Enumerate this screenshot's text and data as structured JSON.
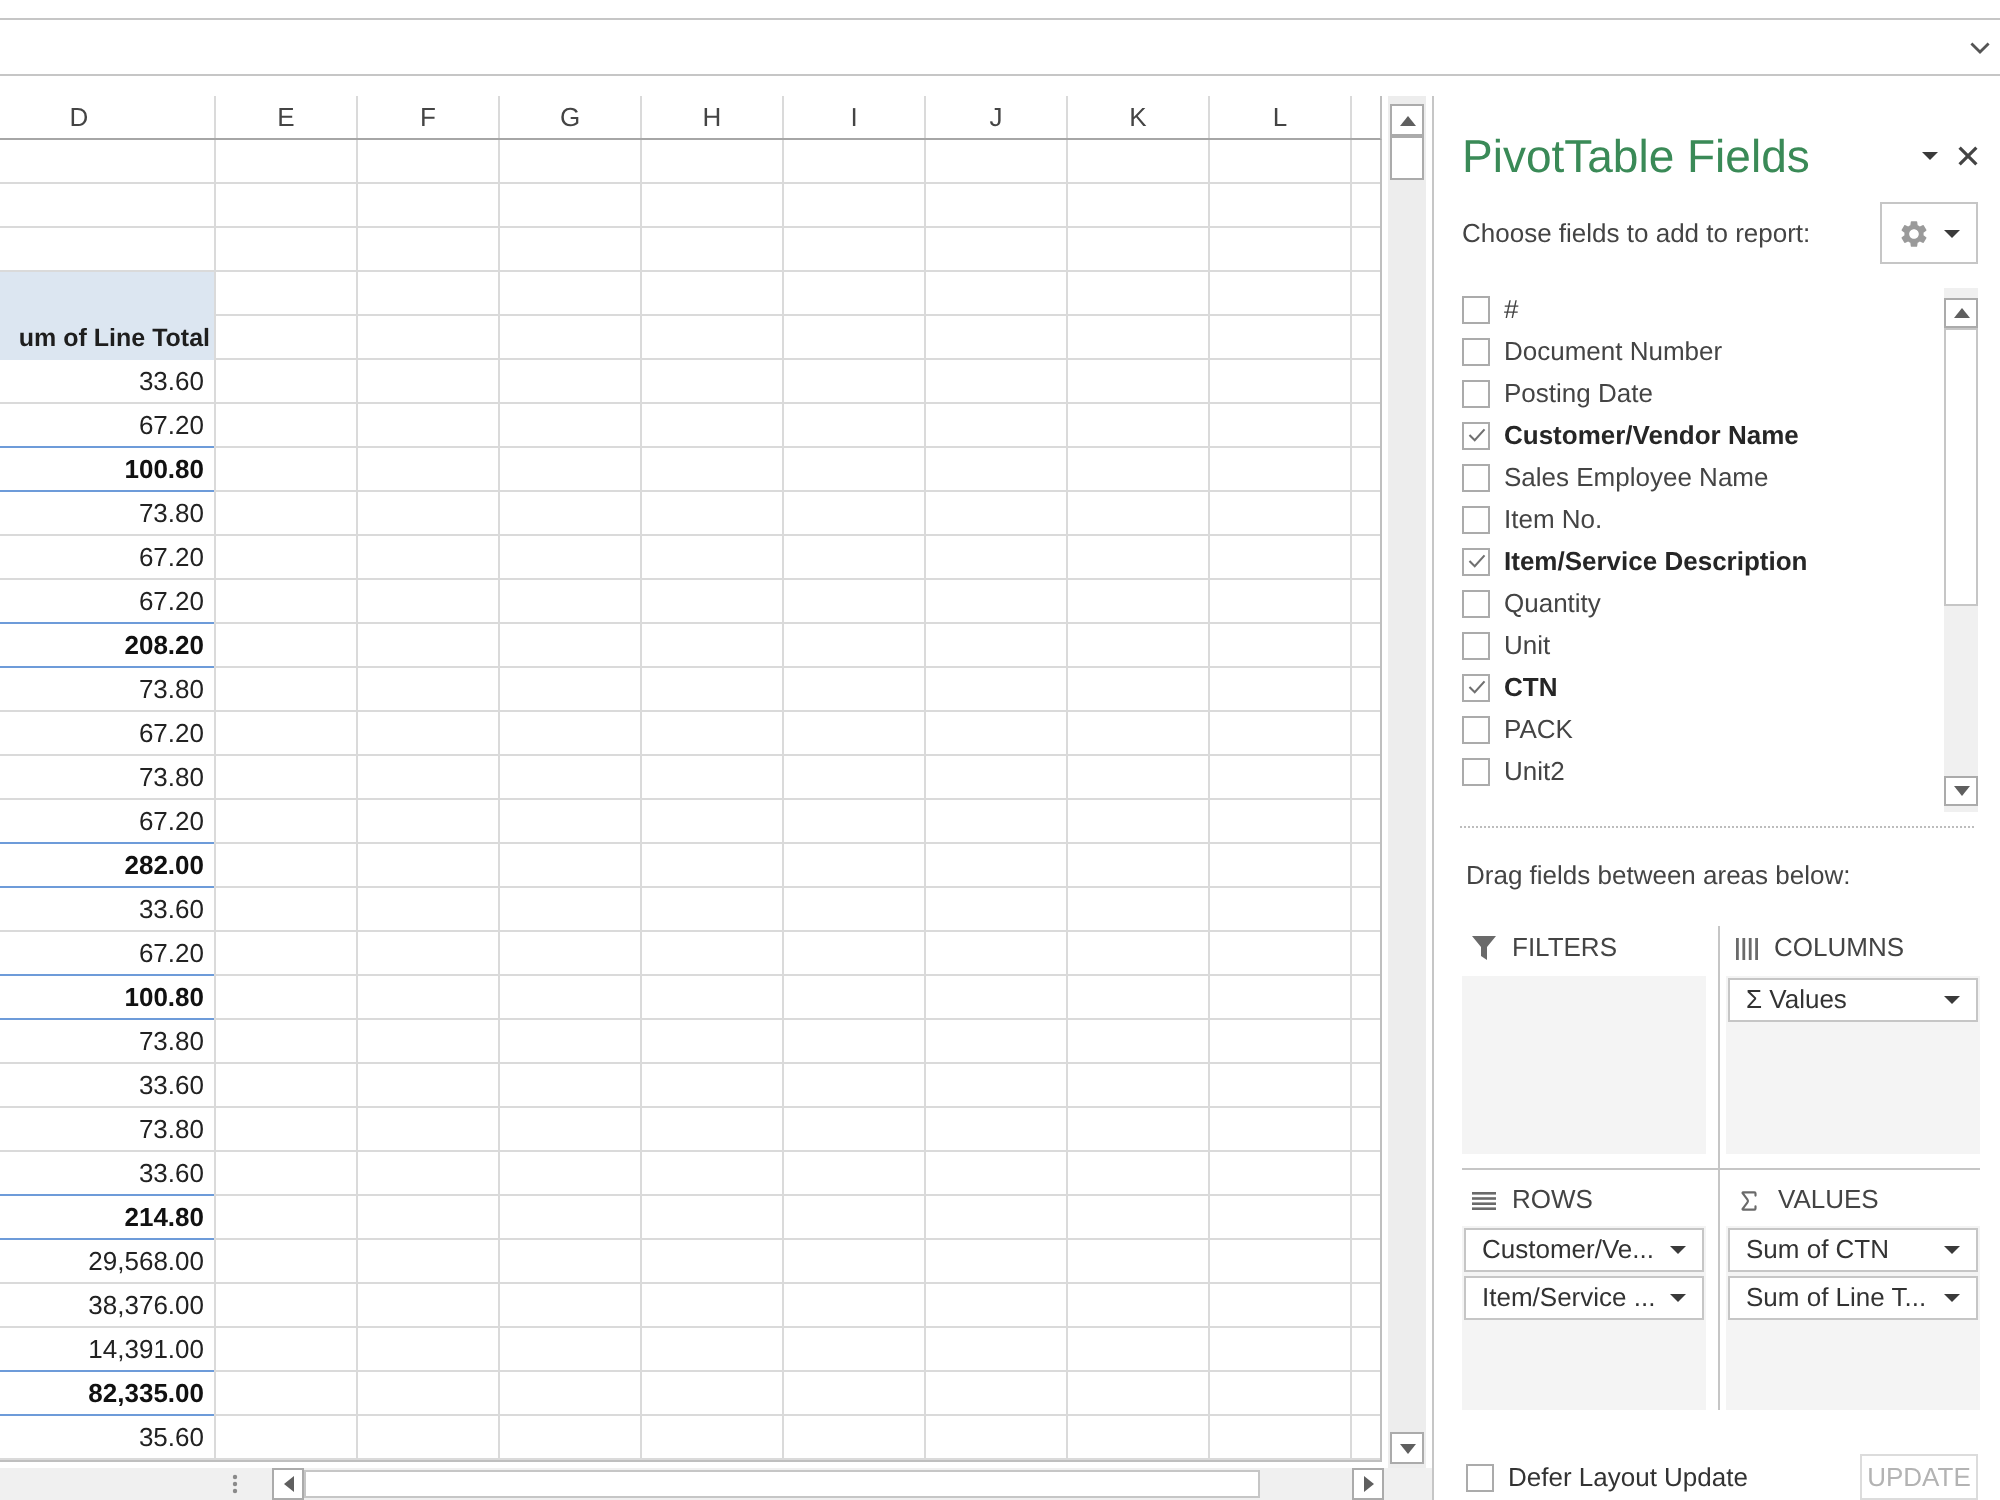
{
  "sheet": {
    "columns": [
      "D",
      "E",
      "F",
      "G",
      "H",
      "I",
      "J",
      "K",
      "L"
    ],
    "rows": [
      {
        "kind": "blank"
      },
      {
        "kind": "blank"
      },
      {
        "kind": "blank"
      },
      {
        "kind": "pivot_header"
      },
      {
        "kind": "pivot_header",
        "text": "um of Line Total"
      },
      {
        "kind": "value",
        "text": "33.60"
      },
      {
        "kind": "value",
        "text": "67.20"
      },
      {
        "kind": "subtotal",
        "text": "100.80"
      },
      {
        "kind": "value",
        "text": "73.80"
      },
      {
        "kind": "value",
        "text": "67.20"
      },
      {
        "kind": "value",
        "text": "67.20"
      },
      {
        "kind": "subtotal",
        "text": "208.20"
      },
      {
        "kind": "value",
        "text": "73.80"
      },
      {
        "kind": "value",
        "text": "67.20"
      },
      {
        "kind": "value",
        "text": "73.80"
      },
      {
        "kind": "value",
        "text": "67.20"
      },
      {
        "kind": "subtotal",
        "text": "282.00"
      },
      {
        "kind": "value",
        "text": "33.60"
      },
      {
        "kind": "value",
        "text": "67.20"
      },
      {
        "kind": "subtotal",
        "text": "100.80"
      },
      {
        "kind": "value",
        "text": "73.80"
      },
      {
        "kind": "value",
        "text": "33.60"
      },
      {
        "kind": "value",
        "text": "73.80"
      },
      {
        "kind": "value",
        "text": "33.60"
      },
      {
        "kind": "subtotal",
        "text": "214.80"
      },
      {
        "kind": "value",
        "text": "29,568.00"
      },
      {
        "kind": "value",
        "text": "38,376.00"
      },
      {
        "kind": "value",
        "text": "14,391.00"
      },
      {
        "kind": "subtotal",
        "text": "82,335.00"
      },
      {
        "kind": "value",
        "text": "35.60"
      }
    ]
  },
  "pivot_panel": {
    "title": "PivotTable Fields",
    "subtitle": "Choose fields to add to report:",
    "fields": [
      {
        "label": "#",
        "checked": false
      },
      {
        "label": "Document Number",
        "checked": false
      },
      {
        "label": "Posting Date",
        "checked": false
      },
      {
        "label": "Customer/Vendor Name",
        "checked": true
      },
      {
        "label": "Sales Employee Name",
        "checked": false
      },
      {
        "label": "Item No.",
        "checked": false
      },
      {
        "label": "Item/Service Description",
        "checked": true
      },
      {
        "label": "Quantity",
        "checked": false
      },
      {
        "label": "Unit",
        "checked": false
      },
      {
        "label": "CTN",
        "checked": true
      },
      {
        "label": "PACK",
        "checked": false
      },
      {
        "label": "Unit2",
        "checked": false
      }
    ],
    "areas_hint": "Drag fields between areas below:",
    "areas": [
      {
        "kind": "filters",
        "label": "FILTERS"
      },
      {
        "kind": "columns",
        "label": "COLUMNS",
        "items": [
          "Σ Values"
        ]
      },
      {
        "kind": "rows",
        "label": "ROWS",
        "items": [
          "Customer/Ve...",
          "Item/Service ..."
        ]
      },
      {
        "kind": "values",
        "label": "VALUES",
        "items": [
          "Sum of CTN",
          "Sum of Line T..."
        ]
      }
    ],
    "defer_update": {
      "label": "Defer Layout Update",
      "checked": false
    },
    "update_button": {
      "label": "UPDATE",
      "disabled": true
    }
  }
}
